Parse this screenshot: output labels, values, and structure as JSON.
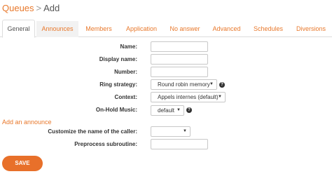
{
  "breadcrumb": {
    "parent": "Queues",
    "separator": ">",
    "current": "Add"
  },
  "tabs": [
    "General",
    "Announces",
    "Members",
    "Application",
    "No answer",
    "Advanced",
    "Schedules",
    "Diversions"
  ],
  "form": {
    "name": {
      "label": "Name:",
      "value": ""
    },
    "display_name": {
      "label": "Display name:",
      "value": ""
    },
    "number": {
      "label": "Number:",
      "value": ""
    },
    "ring_strategy": {
      "label": "Ring strategy:",
      "selected": "Round robin memory"
    },
    "context": {
      "label": "Context:",
      "selected": "Appels internes (default)"
    },
    "on_hold_music": {
      "label": "On-Hold Music:",
      "selected": "default"
    },
    "add_announce": "Add an announce",
    "caller_name": {
      "label": "Customize the name of the caller:",
      "selected": ""
    },
    "preprocess": {
      "label": "Preprocess subroutine:",
      "value": ""
    }
  },
  "glyphs": {
    "caret": "▼",
    "help": "?"
  },
  "actions": {
    "save_label": "SAVE"
  },
  "colors": {
    "accent": "#e8782b",
    "save_button": "#e8702a",
    "border": "#dddddd"
  },
  "icons": {
    "help": "question-circle-icon",
    "dropdown": "chevron-down-icon"
  }
}
